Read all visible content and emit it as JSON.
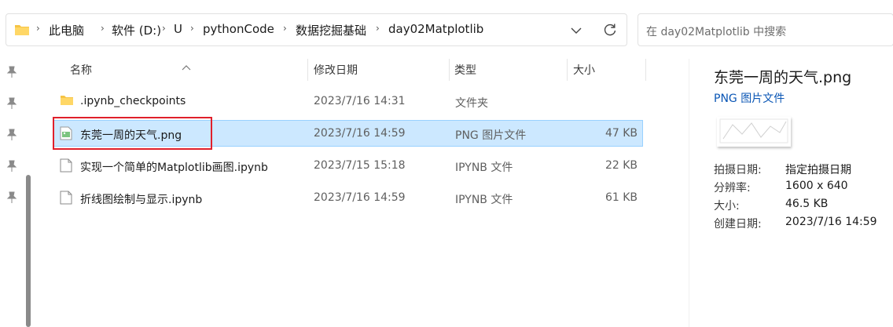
{
  "address": {
    "breadcrumbs": [
      "此电脑",
      "软件 (D:)",
      "U",
      "pythonCode",
      "数据挖掘基础",
      "day02Matplotlib"
    ]
  },
  "search": {
    "placeholder": "在 day02Matplotlib 中搜索"
  },
  "columns": {
    "name": "名称",
    "date": "修改日期",
    "type": "类型",
    "size": "大小"
  },
  "files": [
    {
      "name": ".ipynb_checkpoints",
      "date": "2023/7/16 14:31",
      "type": "文件夹",
      "size": "",
      "icon": "folder-icon"
    },
    {
      "name": "东莞一周的天气.png",
      "date": "2023/7/16 14:59",
      "type": "PNG 图片文件",
      "size": "47 KB",
      "icon": "png-file-icon",
      "selected": true
    },
    {
      "name": "实现一个简单的Matplotlib画图.ipynb",
      "date": "2023/7/15 15:18",
      "type": "IPYNB 文件",
      "size": "22 KB",
      "icon": "document-icon"
    },
    {
      "name": "折线图绘制与显示.ipynb",
      "date": "2023/7/16 14:59",
      "type": "IPYNB 文件",
      "size": "61 KB",
      "icon": "document-icon"
    }
  ],
  "details": {
    "title": "东莞一周的天气.png",
    "subtitle": "PNG 图片文件",
    "props": [
      {
        "label": "拍摄日期:",
        "value": "指定拍摄日期"
      },
      {
        "label": "分辨率:",
        "value": "1600 x 640"
      },
      {
        "label": "大小:",
        "value": "46.5 KB"
      },
      {
        "label": "创建日期:",
        "value": "2023/7/16 14:59"
      }
    ]
  },
  "colors": {
    "selection_bg": "#cce8ff",
    "selection_border": "#99d1ff",
    "highlight_box": "#e0202b",
    "link_blue": "#0a56b5",
    "folder_yellow": "#f6c445"
  }
}
